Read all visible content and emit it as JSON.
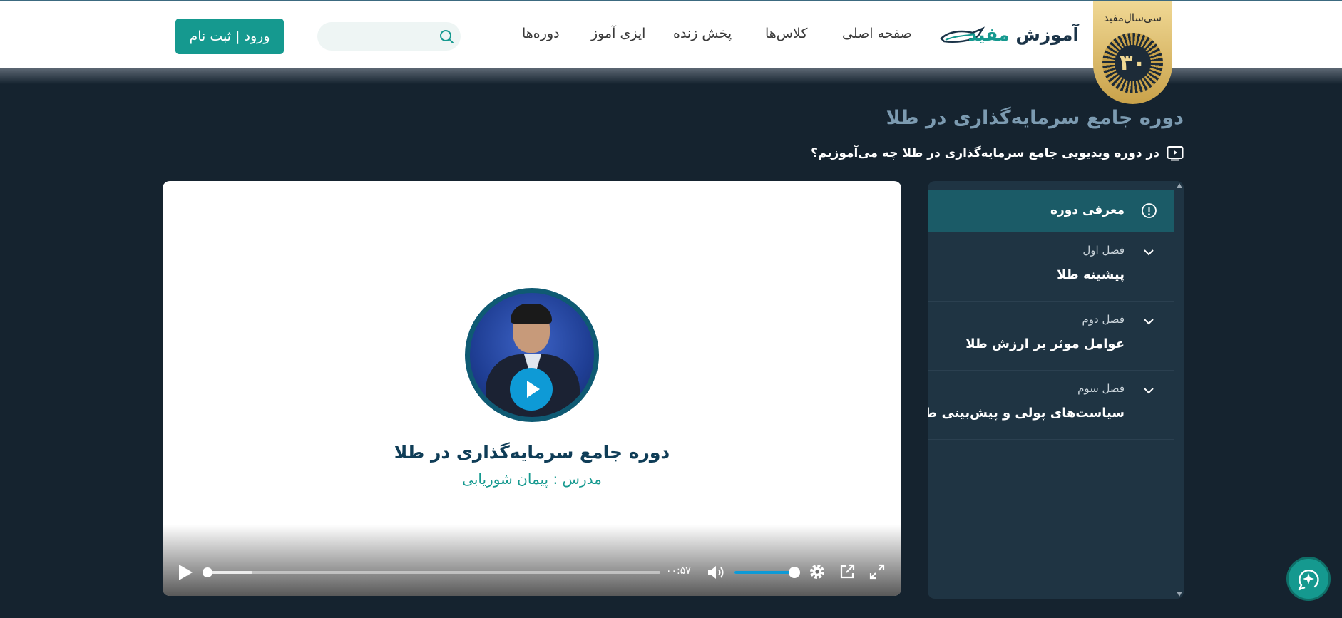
{
  "header": {
    "badge_text": "سی‌سال‌مفید",
    "badge_number": "۳۰",
    "logo_part1": "آموزش",
    "logo_part2": "مفید",
    "nav": [
      "صفحه اصلی",
      "کلاس‌ها",
      "پخش زنده",
      "ایزی آموز",
      "دوره‌ها"
    ],
    "search_placeholder": "",
    "login_label": "ورود | ثبت نام"
  },
  "page": {
    "title": "دوره جامع سرمایه‌گذاری در طلا",
    "subtitle": "در دوره ویدیویی جامع سرمایه‌گذاری در طلا چه می‌آموزیم؟"
  },
  "player": {
    "video_title": "دوره جامع سرمایه‌گذاری در طلا",
    "teacher": "مدرس : پیمان شوریابی",
    "time_display": "۰۰:۵۷",
    "progress": 0.0,
    "buffered": 0.1,
    "volume": 1.0
  },
  "sidebar": {
    "active_item": "معرفی دوره",
    "chapters": [
      {
        "label": "فصل اول",
        "title": "پیشینه طلا"
      },
      {
        "label": "فصل دوم",
        "title": "عوامل موثر بر ارزش طلا"
      },
      {
        "label": "فصل سوم",
        "title": "سیاست‌های پولی و پیش‌بینی طلا"
      }
    ]
  },
  "colors": {
    "brand": "#15998f",
    "background": "#15232f",
    "accent_blue": "#0e9ad6"
  }
}
